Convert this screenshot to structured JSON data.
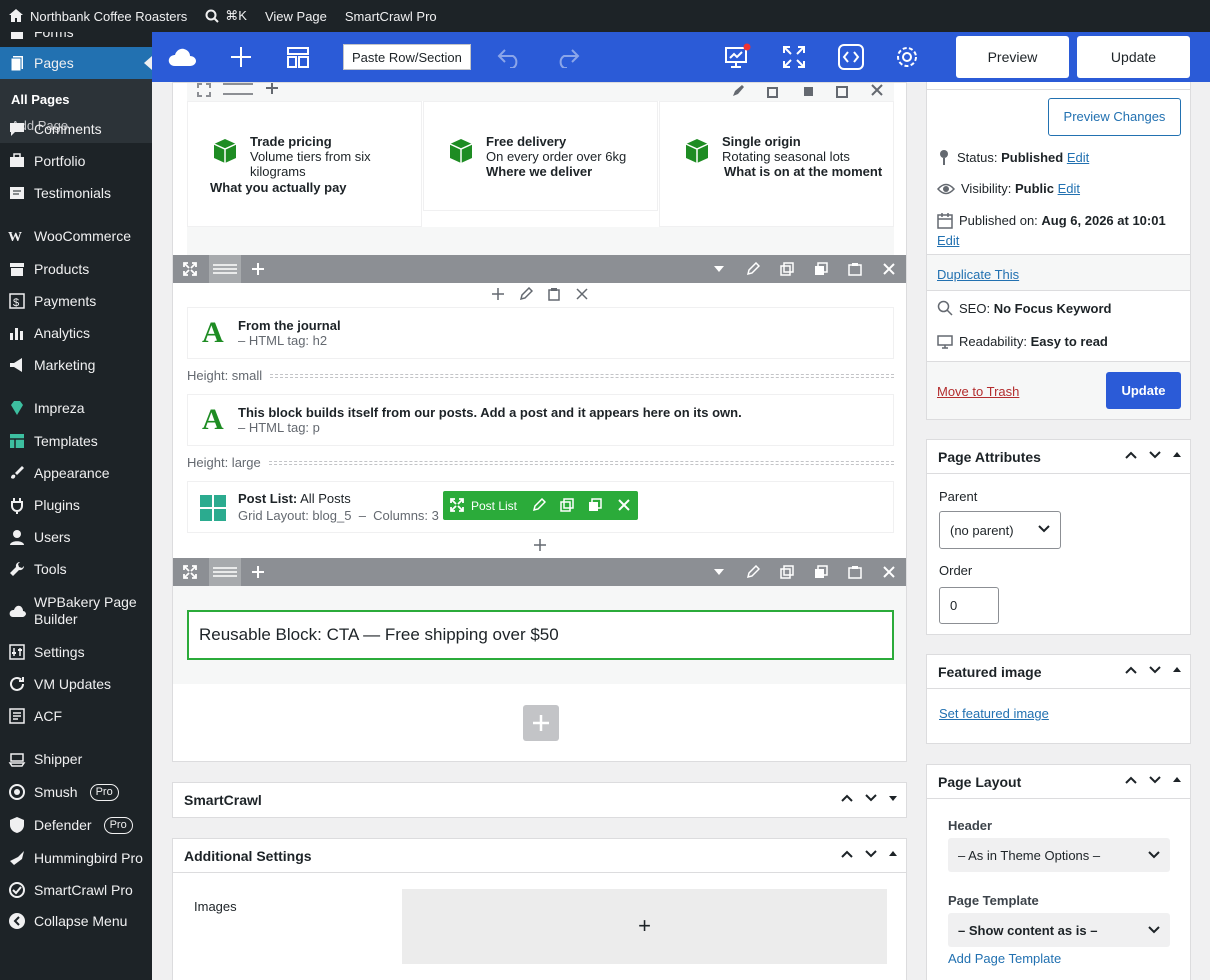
{
  "admin_bar": {
    "site_name": "Northbank Coffee Roasters",
    "search_shortcut": "⌘K",
    "view_page": "View Page",
    "plugin": "SmartCrawl Pro"
  },
  "sidebar": {
    "forms_label": "Forms",
    "pages_label": "Pages",
    "sub_all_pages": "All Pages",
    "sub_add_page": "Add Page",
    "items": [
      {
        "label": "Comments",
        "icon": "comment-icon"
      },
      {
        "label": "Portfolio",
        "icon": "portfolio-icon"
      },
      {
        "label": "Testimonials",
        "icon": "testimonial-icon"
      },
      {
        "label": "WooCommerce",
        "icon": "woo-icon"
      },
      {
        "label": "Products",
        "icon": "archive-icon"
      },
      {
        "label": "Payments",
        "icon": "dollar-icon"
      },
      {
        "label": "Analytics",
        "icon": "bar-chart-icon"
      },
      {
        "label": "Marketing",
        "icon": "megaphone-icon"
      },
      {
        "label": "Impreza",
        "icon": "diamond-icon"
      },
      {
        "label": "Templates",
        "icon": "templates-icon"
      },
      {
        "label": "Appearance",
        "icon": "brush-icon"
      },
      {
        "label": "Plugins",
        "icon": "plug-icon"
      },
      {
        "label": "Users",
        "icon": "user-icon"
      },
      {
        "label": "Tools",
        "icon": "wrench-icon"
      },
      {
        "label": "WPBakery Page Builder",
        "icon": "cloud-icon"
      },
      {
        "label": "Settings",
        "icon": "sliders-icon"
      },
      {
        "label": "VM Updates",
        "icon": "refresh-icon"
      },
      {
        "label": "ACF",
        "icon": "acf-icon"
      },
      {
        "label": "Shipper",
        "icon": "shipper-icon"
      },
      {
        "label": "Smush",
        "icon": "smush-icon",
        "badge": "Pro"
      },
      {
        "label": "Defender",
        "icon": "shield-icon",
        "badge": "Pro"
      },
      {
        "label": "Hummingbird Pro",
        "icon": "hummingbird-icon"
      },
      {
        "label": "SmartCrawl Pro",
        "icon": "smartcrawl-icon"
      },
      {
        "label": "Collapse Menu",
        "icon": "collapse-icon"
      }
    ]
  },
  "toolbar": {
    "paste_label": "Paste Row/Section",
    "preview_label": "Preview",
    "update_label": "Update"
  },
  "features": [
    {
      "title": "Trade pricing",
      "desc": "Volume tiers from six kilograms",
      "link": "What you actually pay"
    },
    {
      "title": "Free delivery",
      "desc": "On every order over 6kg",
      "link": "Where we deliver"
    },
    {
      "title": "Single origin",
      "desc": "Rotating seasonal lots",
      "link": "What is on at the moment"
    }
  ],
  "elements": {
    "heading": {
      "title": "From the journal",
      "meta": "– HTML tag: h2"
    },
    "spacer_small": "Height: small",
    "text": {
      "title": "This block builds itself from our posts. Add a post and it appears here on its own.",
      "meta": "– HTML tag: p"
    },
    "spacer_large": "Height: large",
    "post_list": {
      "title": "Post List:",
      "title_value": "All Posts",
      "meta": "Grid Layout: blog_5  –  Columns: 3",
      "badge": "Post List"
    },
    "reusable": "Reusable Block: CTA — Free shipping over $50"
  },
  "metaboxes": {
    "smartcrawl": "SmartCrawl",
    "additional": "Additional Settings",
    "images_label": "Images",
    "images_add": "+"
  },
  "publish": {
    "preview_changes": "Preview Changes",
    "status_label": "Status:",
    "status_value": "Published",
    "visibility_label": "Visibility:",
    "visibility_value": "Public",
    "published_label": "Published on:",
    "published_value": "Aug 6, 2026 at 10:01",
    "edit": "Edit",
    "duplicate": "Duplicate This",
    "seo_label": "SEO:",
    "seo_value": "No Focus Keyword",
    "read_label": "Readability:",
    "read_value": "Easy to read",
    "trash": "Move to Trash",
    "update": "Update"
  },
  "page_attributes": {
    "title": "Page Attributes",
    "parent_label": "Parent",
    "parent_value": "(no parent)",
    "order_label": "Order",
    "order_value": "0"
  },
  "featured_image": {
    "title": "Featured image",
    "link": "Set featured image"
  },
  "page_layout": {
    "title": "Page Layout",
    "header_label": "Header",
    "header_value": "– As in Theme Options –",
    "template_label": "Page Template",
    "template_value": "– Show content as is –",
    "add_template": "Add Page Template"
  },
  "colors": {
    "wp_blue": "#2271b1",
    "wpb_blue": "#2b5bd7",
    "green": "#2bab3a",
    "admin_dark": "#1d2327"
  }
}
